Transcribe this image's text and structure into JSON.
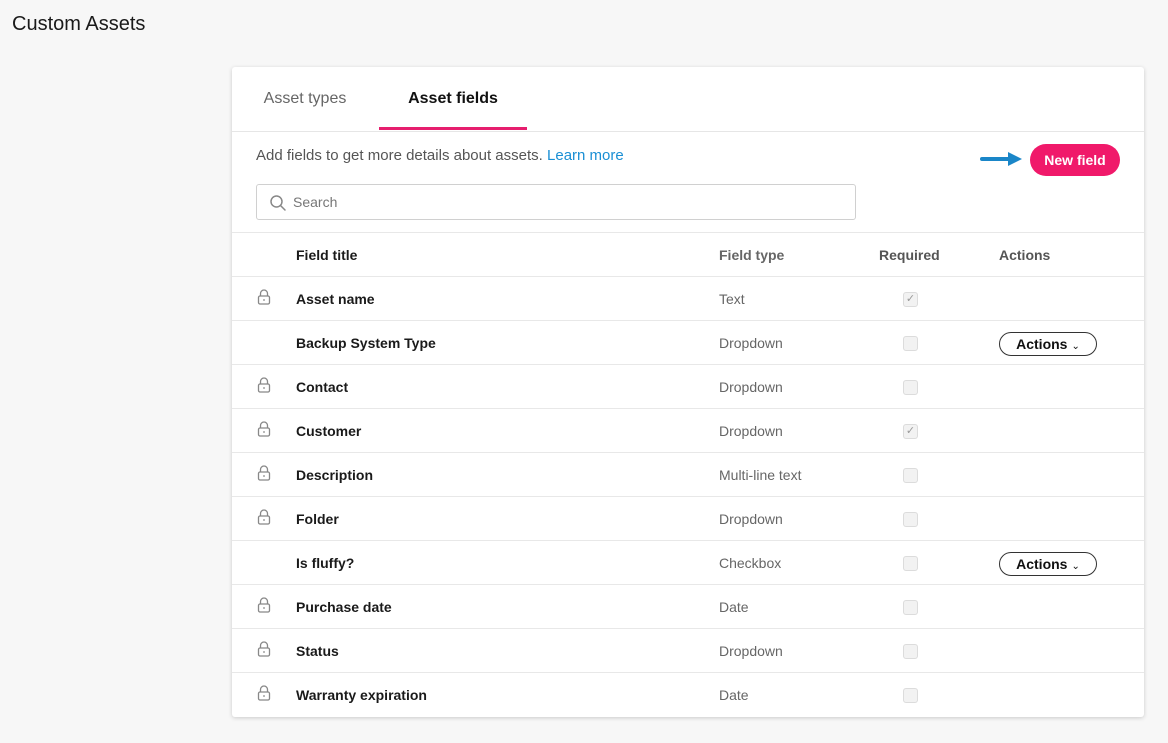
{
  "page": {
    "title": "Custom Assets"
  },
  "tabs": [
    {
      "label": "Asset types",
      "active": false
    },
    {
      "label": "Asset fields",
      "active": true
    }
  ],
  "intro": {
    "text": "Add fields to get more details about assets.",
    "link": "Learn more"
  },
  "new_field_label": "New field",
  "search": {
    "placeholder": "Search",
    "value": ""
  },
  "table": {
    "headers": {
      "title": "Field title",
      "type": "Field type",
      "required": "Required",
      "actions": "Actions"
    },
    "rows": [
      {
        "title": "Asset name",
        "type": "Text",
        "required": true,
        "locked": true,
        "actions": ""
      },
      {
        "title": "Backup System Type",
        "type": "Dropdown",
        "required": false,
        "locked": false,
        "actions": "Actions"
      },
      {
        "title": "Contact",
        "type": "Dropdown",
        "required": false,
        "locked": true,
        "actions": ""
      },
      {
        "title": "Customer",
        "type": "Dropdown",
        "required": true,
        "locked": true,
        "actions": ""
      },
      {
        "title": "Description",
        "type": "Multi-line text",
        "required": false,
        "locked": true,
        "actions": ""
      },
      {
        "title": "Folder",
        "type": "Dropdown",
        "required": false,
        "locked": true,
        "actions": ""
      },
      {
        "title": "Is fluffy?",
        "type": "Checkbox",
        "required": false,
        "locked": false,
        "actions": "Actions"
      },
      {
        "title": "Purchase date",
        "type": "Date",
        "required": false,
        "locked": true,
        "actions": ""
      },
      {
        "title": "Status",
        "type": "Dropdown",
        "required": false,
        "locked": true,
        "actions": ""
      },
      {
        "title": "Warranty expiration",
        "type": "Date",
        "required": false,
        "locked": true,
        "actions": ""
      }
    ]
  },
  "colors": {
    "accent": "#f0196a",
    "tab_underline": "#e61e6e",
    "link": "#1a8fd4",
    "arrow": "#1a86c8"
  },
  "icons": {
    "lock": "lock-icon",
    "search": "search-icon",
    "arrow": "arrow-right-icon",
    "chevron": "chevron-down-icon"
  }
}
